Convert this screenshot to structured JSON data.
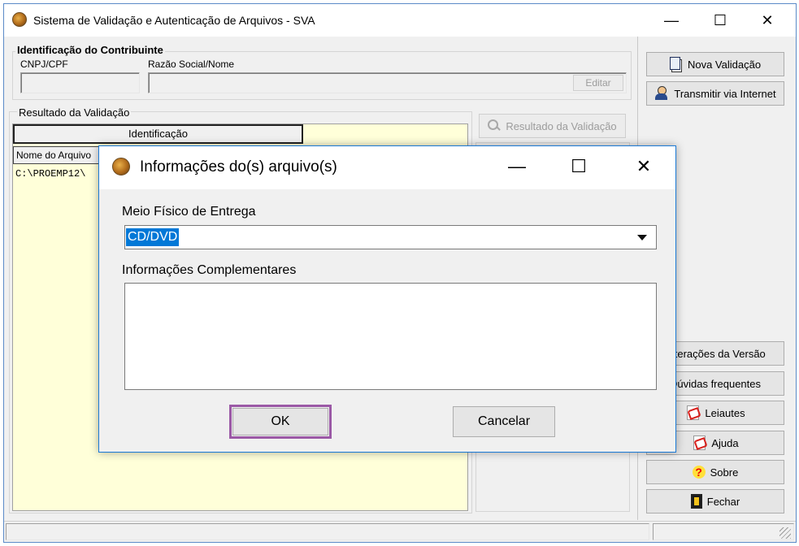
{
  "main_window": {
    "title": "Sistema de Validação e Autenticação de Arquivos - SVA",
    "controls": {
      "minimize": "—",
      "maximize": "☐",
      "close": "✕"
    }
  },
  "contribuinte": {
    "group_title": "Identificação do Contribuinte",
    "cnpj_label": "CNPJ/CPF",
    "razao_label": "Razão Social/Nome",
    "cnpj_value": "",
    "razao_value": "",
    "edit_button": "Editar"
  },
  "resultado": {
    "group_title": "Resultado da Validação",
    "identificacao_header": "Identificação",
    "nome_arquivo_header": "Nome do Arquivo",
    "file_path": "C:\\PROEMP12\\",
    "resultado_button": "Resultado da Validação"
  },
  "side_buttons": {
    "nova_validacao": "Nova Validação",
    "transmitir": "Transmitir via Internet",
    "alteracoes": "Alterações da Versão",
    "duvidas": "Dúvidas frequentes",
    "leiautes": "Leiautes",
    "ajuda": "Ajuda",
    "sobre": "Sobre",
    "fechar": "Fechar"
  },
  "dialog": {
    "title": "Informações do(s) arquivo(s)",
    "meio_label": "Meio Físico de Entrega",
    "meio_value": "CD/DVD",
    "info_label": "Informações Complementares",
    "info_value": "",
    "ok_button": "OK",
    "cancel_button": "Cancelar",
    "highlight_color": "#9b59a6",
    "selection_color": "#0078d7"
  },
  "icons": {
    "app": "app-logo-icon",
    "nova_validacao": "document-icon",
    "transmitir": "user-network-icon",
    "leiautes": "pdf-icon",
    "ajuda": "pdf-icon",
    "sobre": "question-icon",
    "fechar": "exit-door-icon",
    "resultado": "search-icon"
  }
}
